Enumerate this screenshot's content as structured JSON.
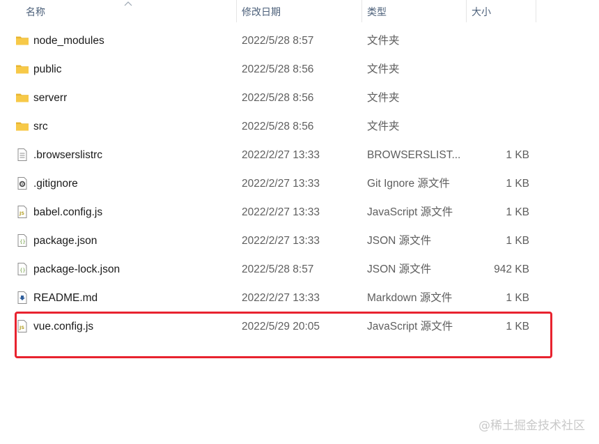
{
  "header": {
    "name_label": "名称",
    "date_label": "修改日期",
    "type_label": "类型",
    "size_label": "大小"
  },
  "files": [
    {
      "name": "node_modules",
      "date": "2022/5/28 8:57",
      "type": "文件夹",
      "size": "",
      "icon": "folder-icon"
    },
    {
      "name": "public",
      "date": "2022/5/28 8:56",
      "type": "文件夹",
      "size": "",
      "icon": "folder-icon"
    },
    {
      "name": "serverr",
      "date": "2022/5/28 8:56",
      "type": "文件夹",
      "size": "",
      "icon": "folder-icon"
    },
    {
      "name": "src",
      "date": "2022/5/28 8:56",
      "type": "文件夹",
      "size": "",
      "icon": "folder-icon"
    },
    {
      "name": ".browserslistrc",
      "date": "2022/2/27 13:33",
      "type": "BROWSERSLIST...",
      "size": "1 KB",
      "icon": "text-file-icon"
    },
    {
      "name": ".gitignore",
      "date": "2022/2/27 13:33",
      "type": "Git Ignore 源文件",
      "size": "1 KB",
      "icon": "gear-file-icon"
    },
    {
      "name": "babel.config.js",
      "date": "2022/2/27 13:33",
      "type": "JavaScript 源文件",
      "size": "1 KB",
      "icon": "js-file-icon"
    },
    {
      "name": "package.json",
      "date": "2022/2/27 13:33",
      "type": "JSON 源文件",
      "size": "1 KB",
      "icon": "json-file-icon"
    },
    {
      "name": "package-lock.json",
      "date": "2022/5/28 8:57",
      "type": "JSON 源文件",
      "size": "942 KB",
      "icon": "json-file-icon"
    },
    {
      "name": "README.md",
      "date": "2022/2/27 13:33",
      "type": "Markdown 源文件",
      "size": "1 KB",
      "icon": "markdown-file-icon"
    },
    {
      "name": "vue.config.js",
      "date": "2022/5/29 20:05",
      "type": "JavaScript 源文件",
      "size": "1 KB",
      "icon": "js-file-icon"
    }
  ],
  "watermark": "@稀土掘金技术社区",
  "colors": {
    "folder": "#f7c948",
    "highlight": "#e8232f",
    "header_text": "#4c607a"
  }
}
